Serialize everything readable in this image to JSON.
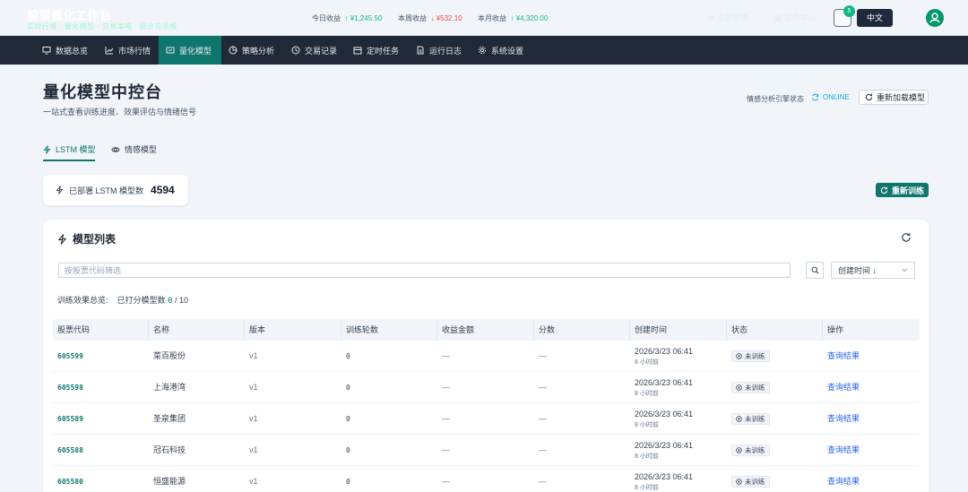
{
  "header": {
    "app_title": "股票量化工作台",
    "app_subtitle": "实时行情 · 量化模型 · 交易策略 · 统计与运维",
    "earnings": [
      {
        "label": "今日收益",
        "value": "¥1,245.50",
        "direction": "up"
      },
      {
        "label": "本周收益",
        "value": "¥532.10",
        "direction": "down"
      },
      {
        "label": "本月收益",
        "value": "¥4,320.00",
        "direction": "up"
      }
    ],
    "ghost_buttons": [
      "立即刷新",
      "操作中心"
    ],
    "notification_count": "5",
    "language": "中文"
  },
  "nav": {
    "items": [
      {
        "label": "数据总览",
        "icon": "monitor-icon"
      },
      {
        "label": "市场行情",
        "icon": "chart-line-icon"
      },
      {
        "label": "量化模型",
        "icon": "model-icon",
        "active": true
      },
      {
        "label": "策略分析",
        "icon": "pie-icon"
      },
      {
        "label": "交易记录",
        "icon": "history-icon"
      },
      {
        "label": "定时任务",
        "icon": "calendar-icon"
      },
      {
        "label": "运行日志",
        "icon": "document-icon"
      },
      {
        "label": "系统设置",
        "icon": "gear-icon"
      }
    ]
  },
  "page": {
    "title": "量化模型中控台",
    "subtitle": "一站式查看训练进度、效果评估与情绪信号",
    "engine_label": "情感分析引擎状态",
    "engine_status": "ONLINE",
    "reload_label": "重新加载模型"
  },
  "tabs": [
    {
      "label": "LSTM 模型",
      "active": true
    },
    {
      "label": "情感模型",
      "active": false
    }
  ],
  "stat": {
    "label": "已部署 LSTM 模型数",
    "value": "4594"
  },
  "retrain_label": "重新训练",
  "panel": {
    "title": "模型列表",
    "search_placeholder": "按股票代码筛选",
    "sort_label": "创建时间 ↓",
    "summary_label": "训练效果总览:",
    "summary_scored_label": "已打分模型数",
    "summary_scored": "0",
    "summary_total": "/ 10"
  },
  "table": {
    "columns": [
      "股票代码",
      "名称",
      "版本",
      "训练轮数",
      "收益金额",
      "分数",
      "创建时间",
      "状态",
      "操作"
    ],
    "rows": [
      {
        "code": "605599",
        "name": "菜百股份",
        "version": "v1",
        "epochs": "0",
        "profit": "—",
        "score": "—",
        "created": "2026/3/23 06:41",
        "ago": "8 小时前",
        "status": "未训练",
        "action": "查询结果"
      },
      {
        "code": "605598",
        "name": "上海港湾",
        "version": "v1",
        "epochs": "0",
        "profit": "—",
        "score": "—",
        "created": "2026/3/23 06:41",
        "ago": "8 小时前",
        "status": "未训练",
        "action": "查询结果"
      },
      {
        "code": "605589",
        "name": "圣泉集团",
        "version": "v1",
        "epochs": "0",
        "profit": "—",
        "score": "—",
        "created": "2026/3/23 06:41",
        "ago": "8 小时前",
        "status": "未训练",
        "action": "查询结果"
      },
      {
        "code": "605588",
        "name": "冠石科技",
        "version": "v1",
        "epochs": "0",
        "profit": "—",
        "score": "—",
        "created": "2026/3/23 06:41",
        "ago": "8 小时前",
        "status": "未训练",
        "action": "查询结果"
      },
      {
        "code": "605580",
        "name": "恒盛能源",
        "version": "v1",
        "epochs": "0",
        "profit": "—",
        "score": "—",
        "created": "2026/3/23 06:41",
        "ago": "8 小时前",
        "status": "未训练",
        "action": "查询结果"
      }
    ]
  },
  "colors": {
    "accent": "#0f766e",
    "nav_bg": "#1f2937",
    "up": "#10b981",
    "down": "#ef4444",
    "link": "#2563eb"
  }
}
